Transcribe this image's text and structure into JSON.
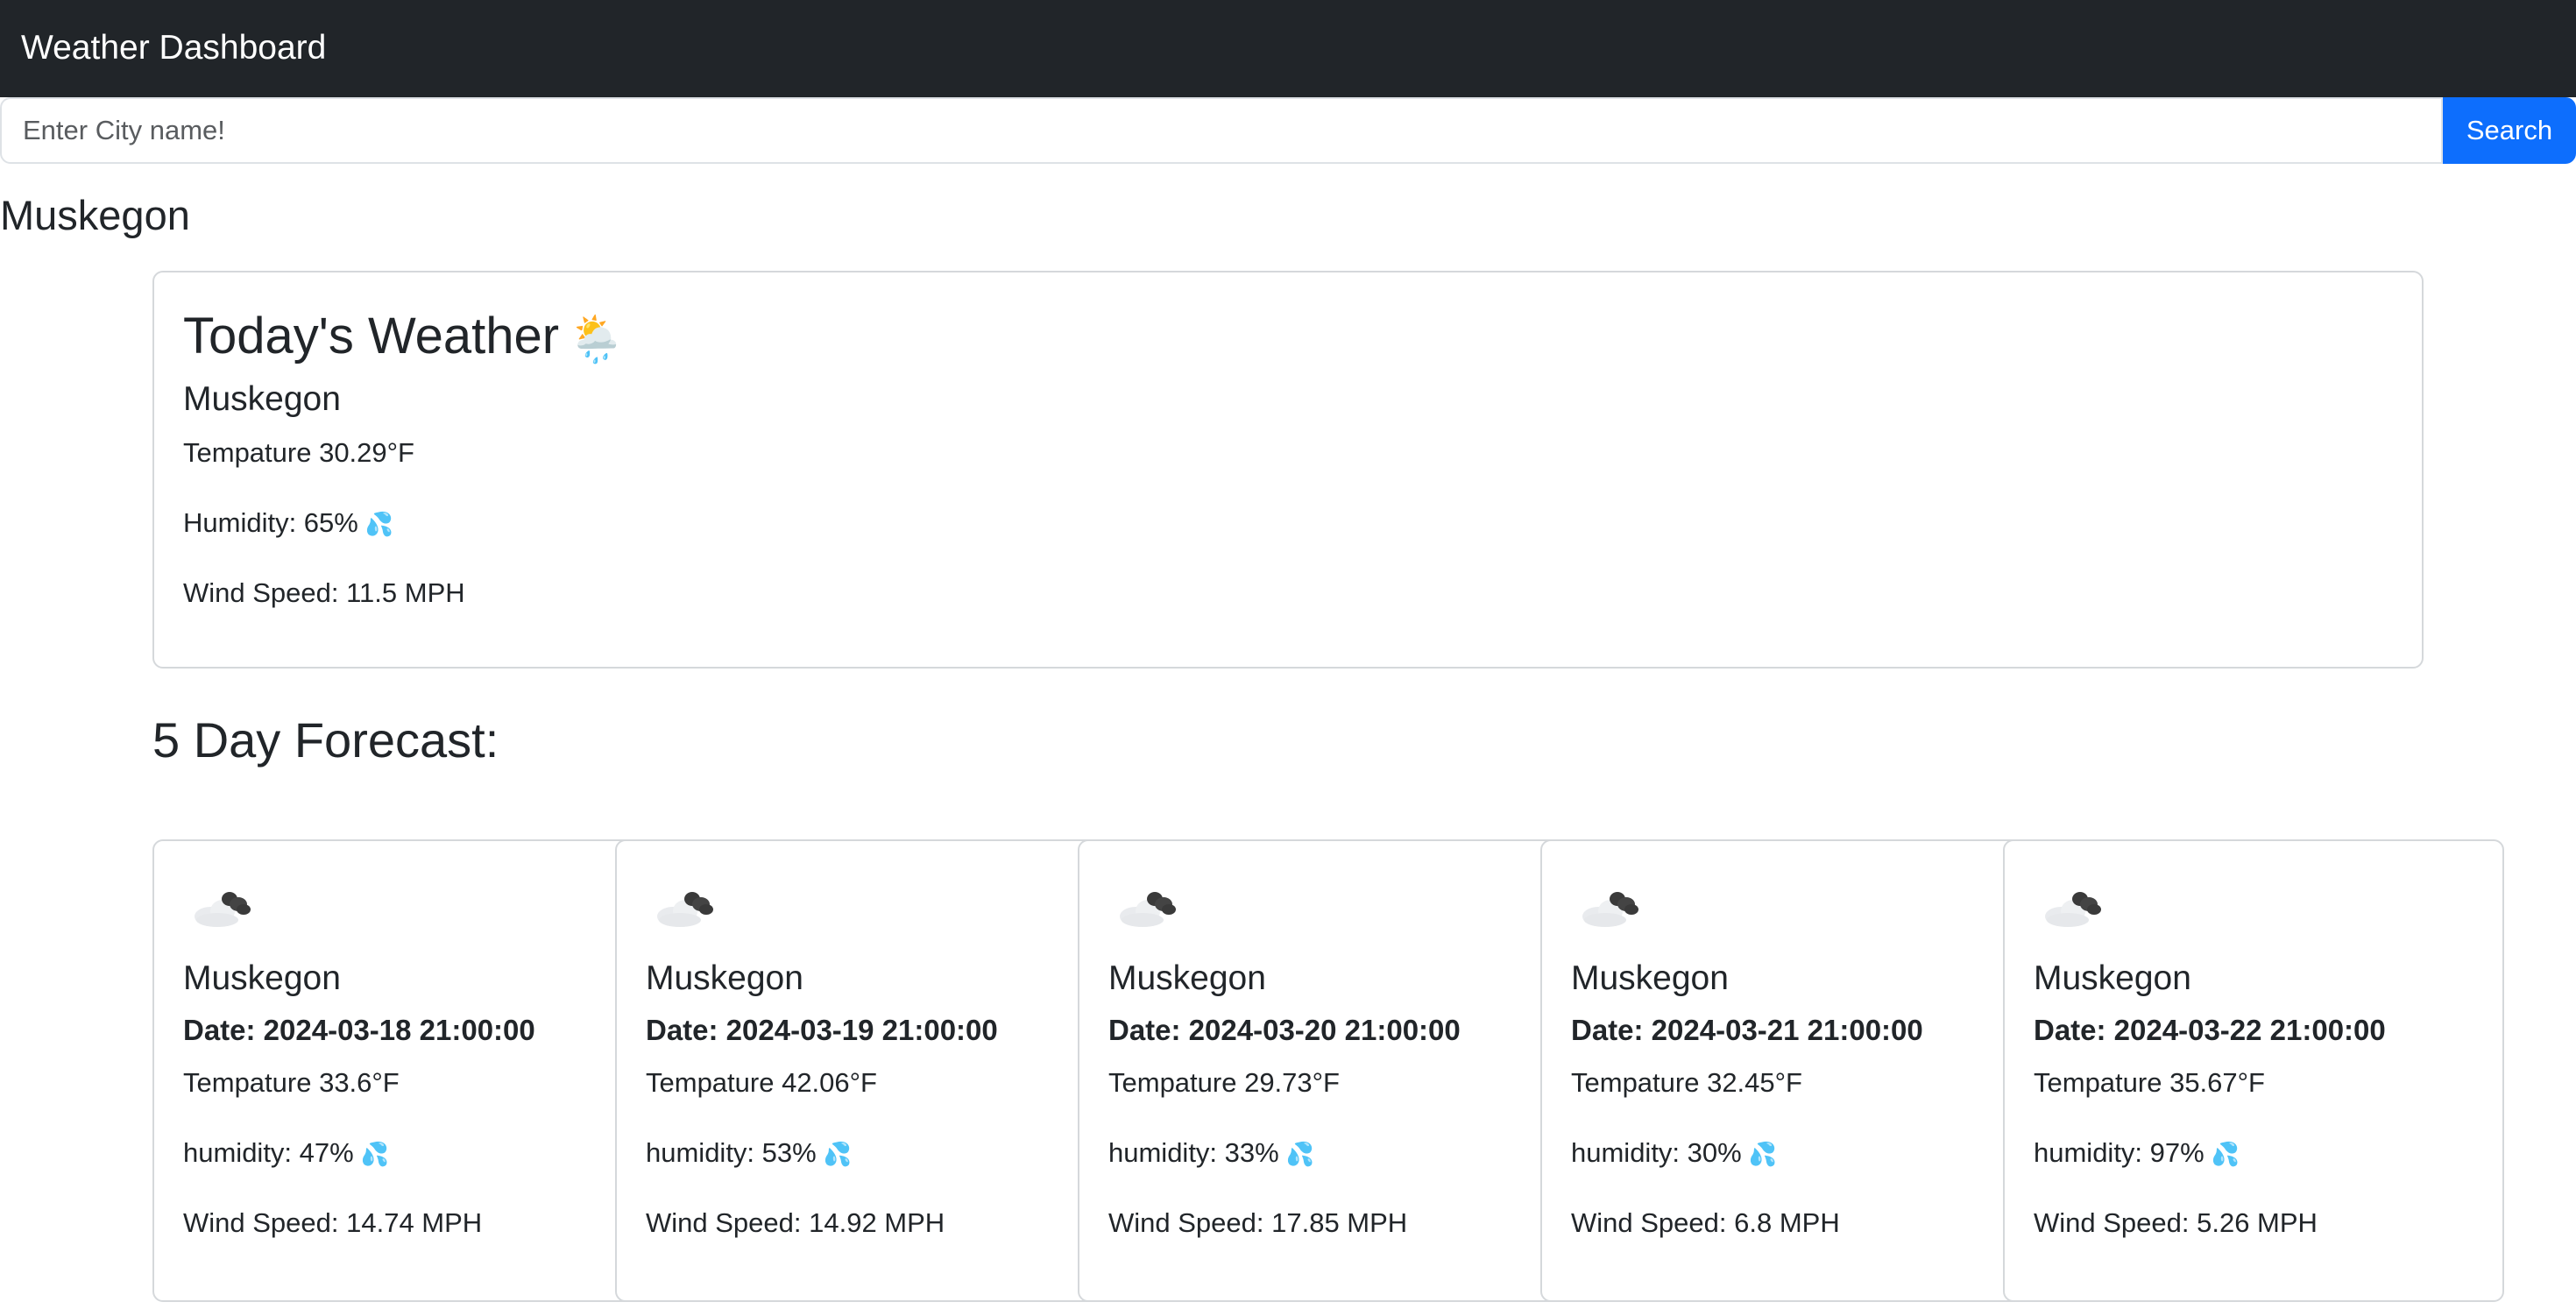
{
  "app": {
    "title": "Weather Dashboard"
  },
  "search": {
    "placeholder": "Enter City name!",
    "value": "",
    "button_label": "Search"
  },
  "city_heading": "Muskegon",
  "today": {
    "title": "Today's Weather",
    "icon": "sun-behind-rain-cloud-icon",
    "icon_glyph": "🌦️",
    "city": "Muskegon",
    "temperature": "Tempature 30.29°F",
    "humidity": "Humidity: 65%",
    "humidity_icon": "💦",
    "wind": "Wind Speed: 11.5 MPH"
  },
  "forecast": {
    "heading": "5 Day Forecast:",
    "days": [
      {
        "icon": "dark-cloud-icon",
        "city": "Muskegon",
        "date": "Date: 2024-03-18 21:00:00",
        "temperature": "Tempature 33.6°F",
        "humidity": "humidity: 47%",
        "humidity_icon": "💦",
        "wind": "Wind Speed: 14.74 MPH"
      },
      {
        "icon": "dark-cloud-icon",
        "city": "Muskegon",
        "date": "Date: 2024-03-19 21:00:00",
        "temperature": "Tempature 42.06°F",
        "humidity": "humidity: 53%",
        "humidity_icon": "💦",
        "wind": "Wind Speed: 14.92 MPH"
      },
      {
        "icon": "dark-cloud-icon",
        "city": "Muskegon",
        "date": "Date: 2024-03-20 21:00:00",
        "temperature": "Tempature 29.73°F",
        "humidity": "humidity: 33%",
        "humidity_icon": "💦",
        "wind": "Wind Speed: 17.85 MPH"
      },
      {
        "icon": "dark-cloud-icon",
        "city": "Muskegon",
        "date": "Date: 2024-03-21 21:00:00",
        "temperature": "Tempature 32.45°F",
        "humidity": "humidity: 30%",
        "humidity_icon": "💦",
        "wind": "Wind Speed: 6.8 MPH"
      },
      {
        "icon": "dark-cloud-icon",
        "city": "Muskegon",
        "date": "Date: 2024-03-22 21:00:00",
        "temperature": "Tempature 35.67°F",
        "humidity": "humidity: 97%",
        "humidity_icon": "💦",
        "wind": "Wind Speed: 5.26 MPH"
      }
    ]
  },
  "colors": {
    "navbar_bg": "#212529",
    "primary": "#0d6efd",
    "text": "#212529",
    "card_border": "#d5d8db"
  }
}
